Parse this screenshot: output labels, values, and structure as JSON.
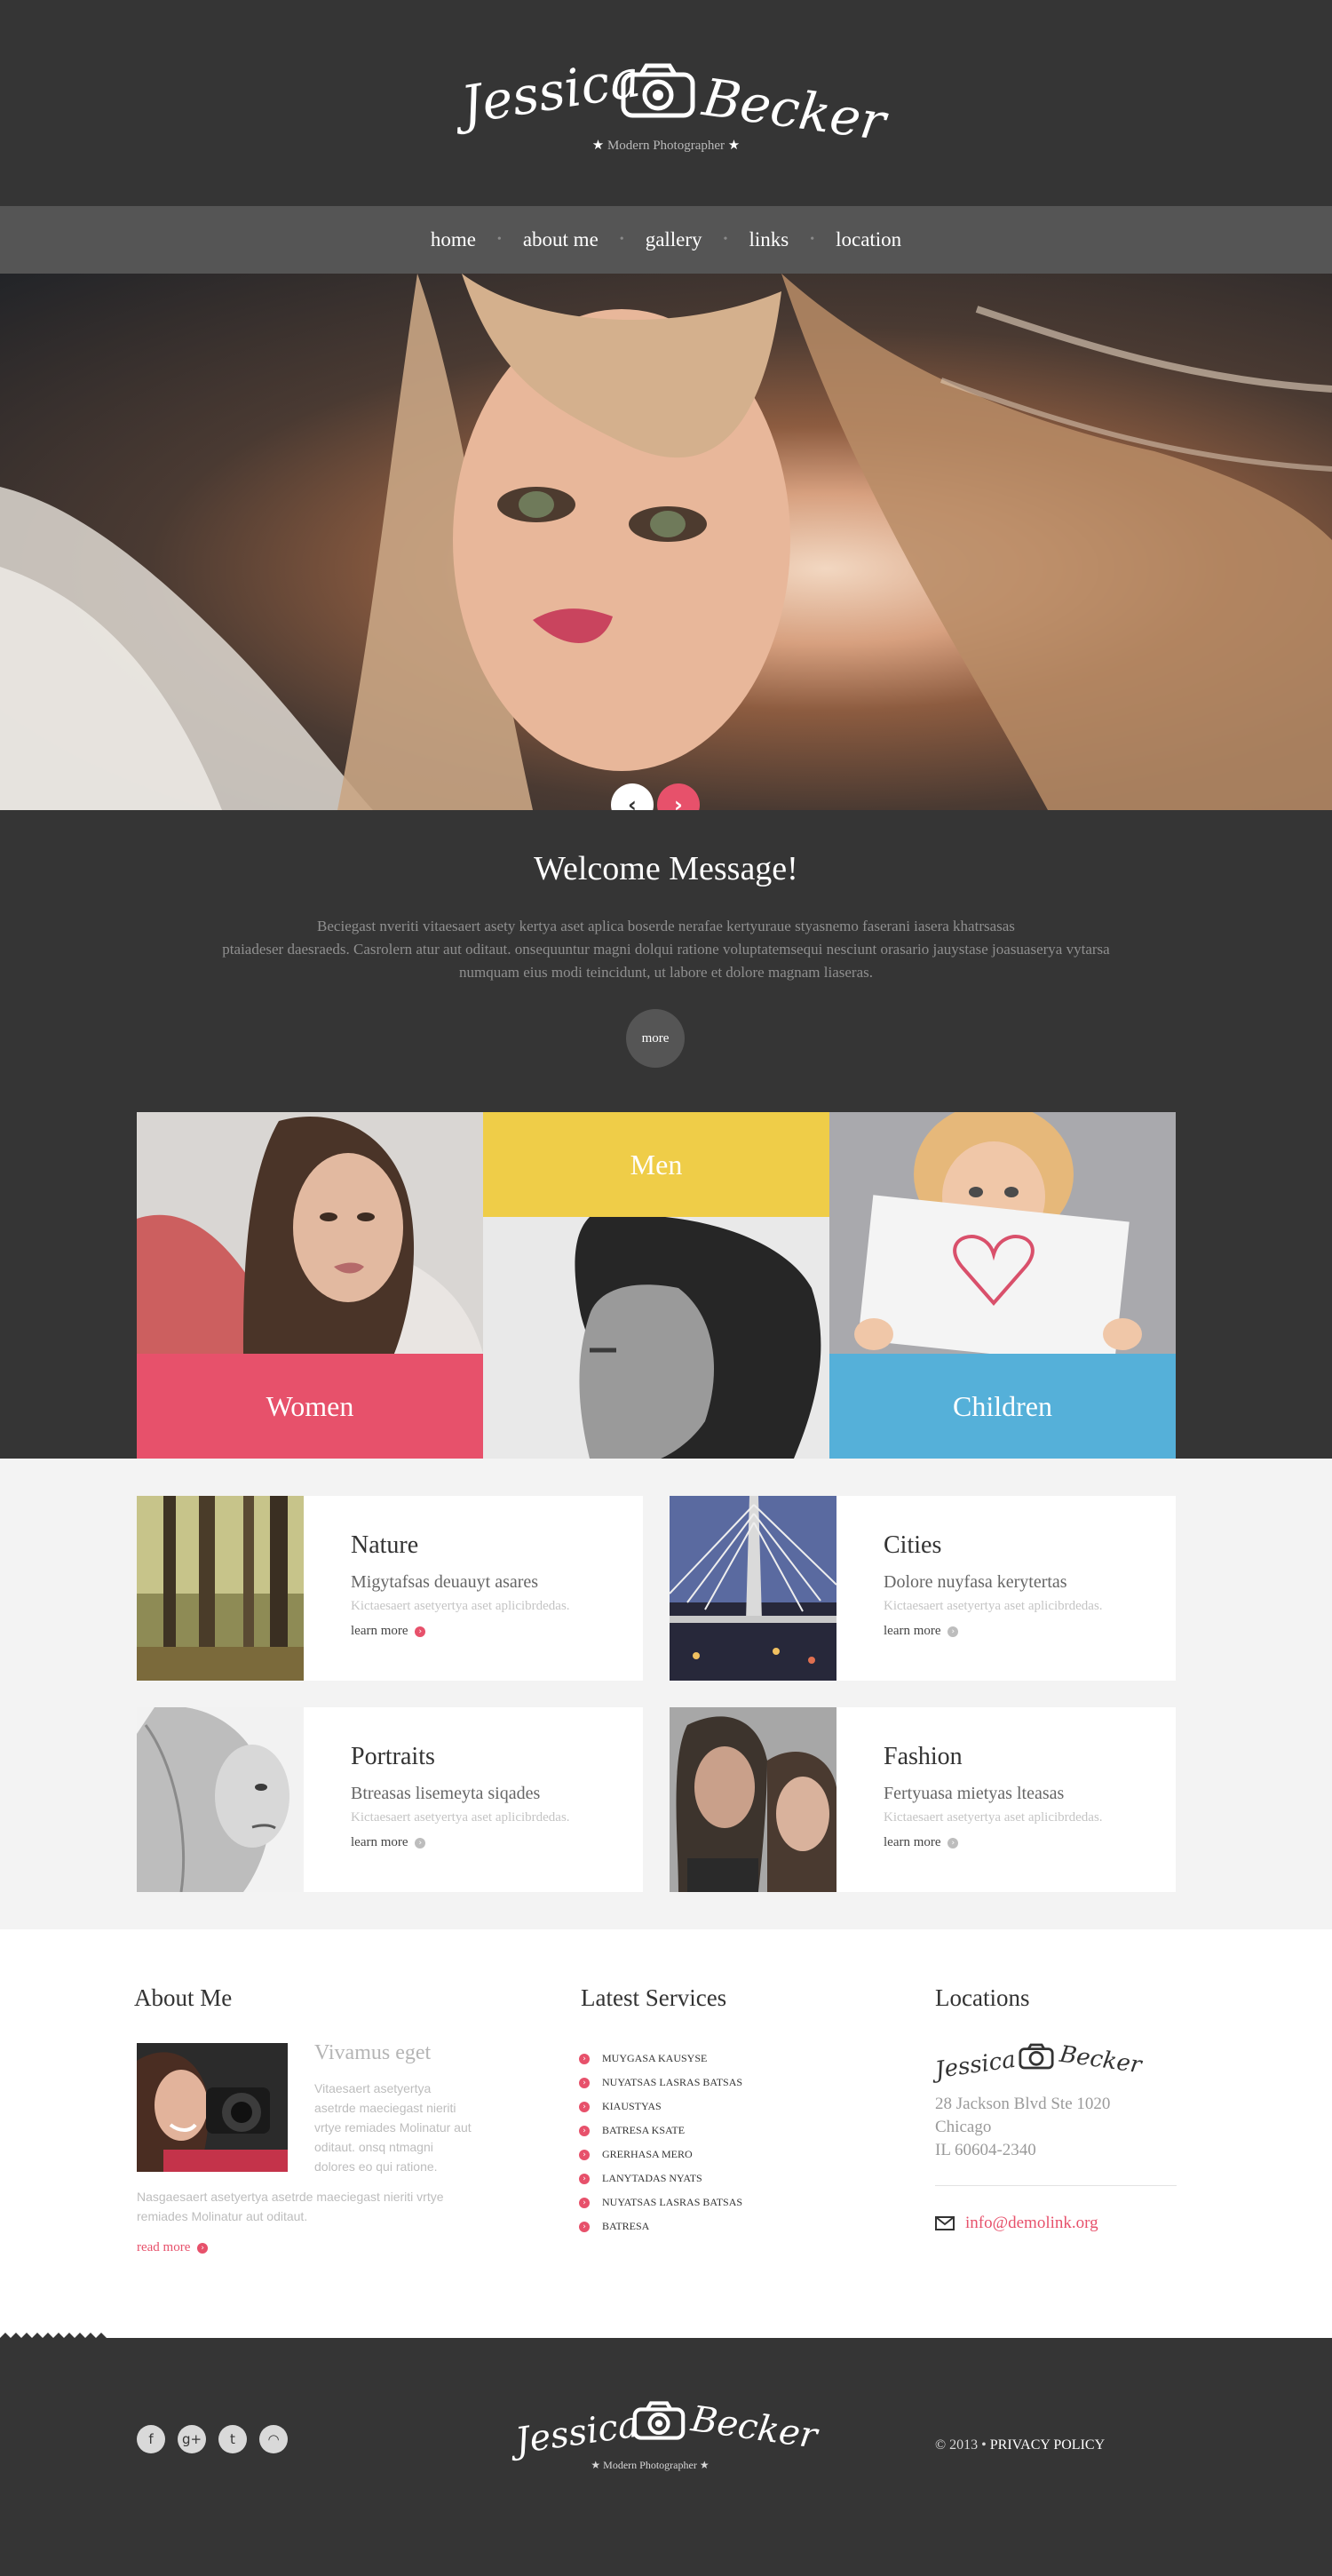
{
  "brand": {
    "first_name": "Jessica",
    "last_name": "Becker",
    "tagline": "Modern Photographer",
    "accent_color": "#e7516b"
  },
  "nav": {
    "items": [
      "home",
      "about me",
      "gallery",
      "links",
      "location"
    ]
  },
  "slider": {
    "prev_icon": "chevron-left-icon",
    "next_icon": "chevron-right-icon"
  },
  "welcome": {
    "title": "Welcome Message!",
    "text_line1": "Beciegast nveriti vitaesaert asety kertya aset aplica boserde nerafae kertyuraue styasnemo faserani  iasera khatrsasas",
    "text_line2": "ptaiadeser daesraeds. Casrolern atur aut oditaut. onsequuntur magni dolqui ratione voluptatemsequi nesciunt orasario jauystase joasuaserya vytarsa",
    "text_line3": "numquam eius modi teincidunt, ut labore et dolore magnam liaseras.",
    "more_label": "more"
  },
  "tiles": {
    "women": "Women",
    "men": "Men",
    "children": "Children",
    "women_color": "#e7516b",
    "men_color": "#efcd48",
    "children_color": "#55b0d9"
  },
  "categories": [
    {
      "title": "Nature",
      "subtitle": "Migytafsas deuauyt asares",
      "desc": "Kictaesaert asetyertya aset aplicibrdedas.",
      "link": "learn more"
    },
    {
      "title": "Cities",
      "subtitle": "Dolore nuyfasa kerytertas",
      "desc": "Kictaesaert asetyertya aset aplicibrdedas.",
      "link": "learn more"
    },
    {
      "title": "Portraits",
      "subtitle": "Btreasas lisemeyta siqades",
      "desc": "Kictaesaert asetyertya aset aplicibrdedas.",
      "link": "learn more"
    },
    {
      "title": "Fashion",
      "subtitle": "Fertyuasa mietyas lteasas",
      "desc": "Kictaesaert asetyertya aset aplicibrdedas.",
      "link": "learn more"
    }
  ],
  "about": {
    "title": "About Me",
    "heading": "Vivamus eget",
    "p1": "Vitaesaert asetyertya asetrde maeciegast nieriti vrtye remiades Molinatur aut oditaut. onsq ntmagni dolores eo qui ratione.",
    "p2": "Nasgaesaert asetyertya asetrde maeciegast nieriti vrtye remiades Molinatur aut oditaut.",
    "read_more": "read more"
  },
  "services": {
    "title": "Latest Services",
    "items": [
      "MUYGASA KAUSYSE",
      "NUYATSAS LASRAS BATSAS",
      "KIAUSTYAS",
      "BATRESA KSATE",
      "GRERHASA MERO",
      "LANYTADAS NYATS",
      "NUYATSAS LASRAS BATSAS",
      "BATRESA"
    ]
  },
  "locations": {
    "title": "Locations",
    "address_line1": "28 Jackson Blvd Ste 1020",
    "address_line2": "Chicago",
    "address_line3": "IL 60604-2340",
    "email": "info@demolink.org"
  },
  "footer": {
    "copyright": "© 2013",
    "separator": "•",
    "privacy": "PRIVACY POLICY",
    "social": [
      {
        "name": "facebook-icon",
        "glyph": "f"
      },
      {
        "name": "google-plus-icon",
        "glyph": "g+"
      },
      {
        "name": "twitter-icon",
        "glyph": "t"
      },
      {
        "name": "rss-icon",
        "glyph": "◠"
      }
    ]
  }
}
